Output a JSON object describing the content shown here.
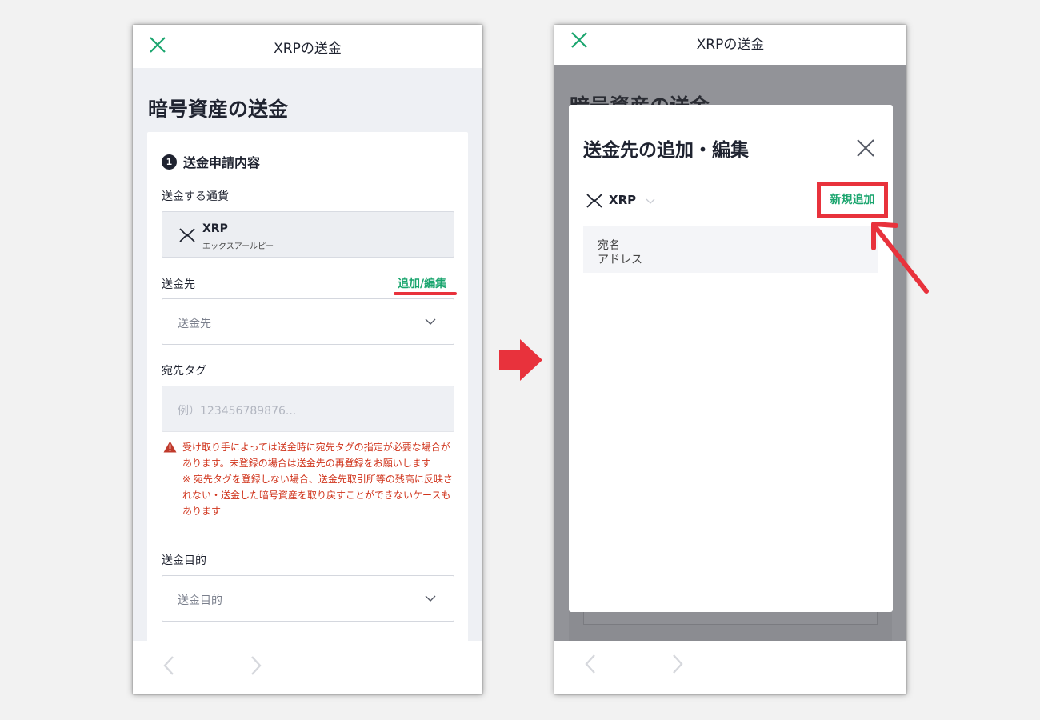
{
  "left_screen": {
    "header_title": "XRPの送金",
    "page_title": "暗号資産の送金",
    "step_number": "1",
    "step_title": "送金申請内容",
    "currency_label": "送金する通貨",
    "currency_code": "XRP",
    "currency_name": "エックスアールピー",
    "destination_label": "送金先",
    "add_edit_link": "追加/編集",
    "destination_placeholder": "送金先",
    "dest_tag_label": "宛先タグ",
    "dest_tag_placeholder": "例）123456789876...",
    "warning_text": "受け取り手によっては送金時に宛先タグの指定が必要な場合があります。未登録の場合は送金先の再登録をお願いします\n※ 宛先タグを登録しない場合、送金先取引所等の残高に反映されない・送金した暗号資産を取り戻すことができないケースもあります",
    "purpose_label": "送金目的",
    "purpose_placeholder": "送金目的"
  },
  "right_screen": {
    "header_title": "XRPの送金",
    "page_title_behind": "暗号資産の送金",
    "modal_title": "送金先の追加・編集",
    "selected_currency": "XRP",
    "new_add_button": "新規追加",
    "dest_name_label": "宛名",
    "dest_address_label": "アドレス"
  },
  "colors": {
    "accent_green": "#1aa56e",
    "highlight_red": "#e8323c",
    "warning_red": "#d0341c"
  }
}
